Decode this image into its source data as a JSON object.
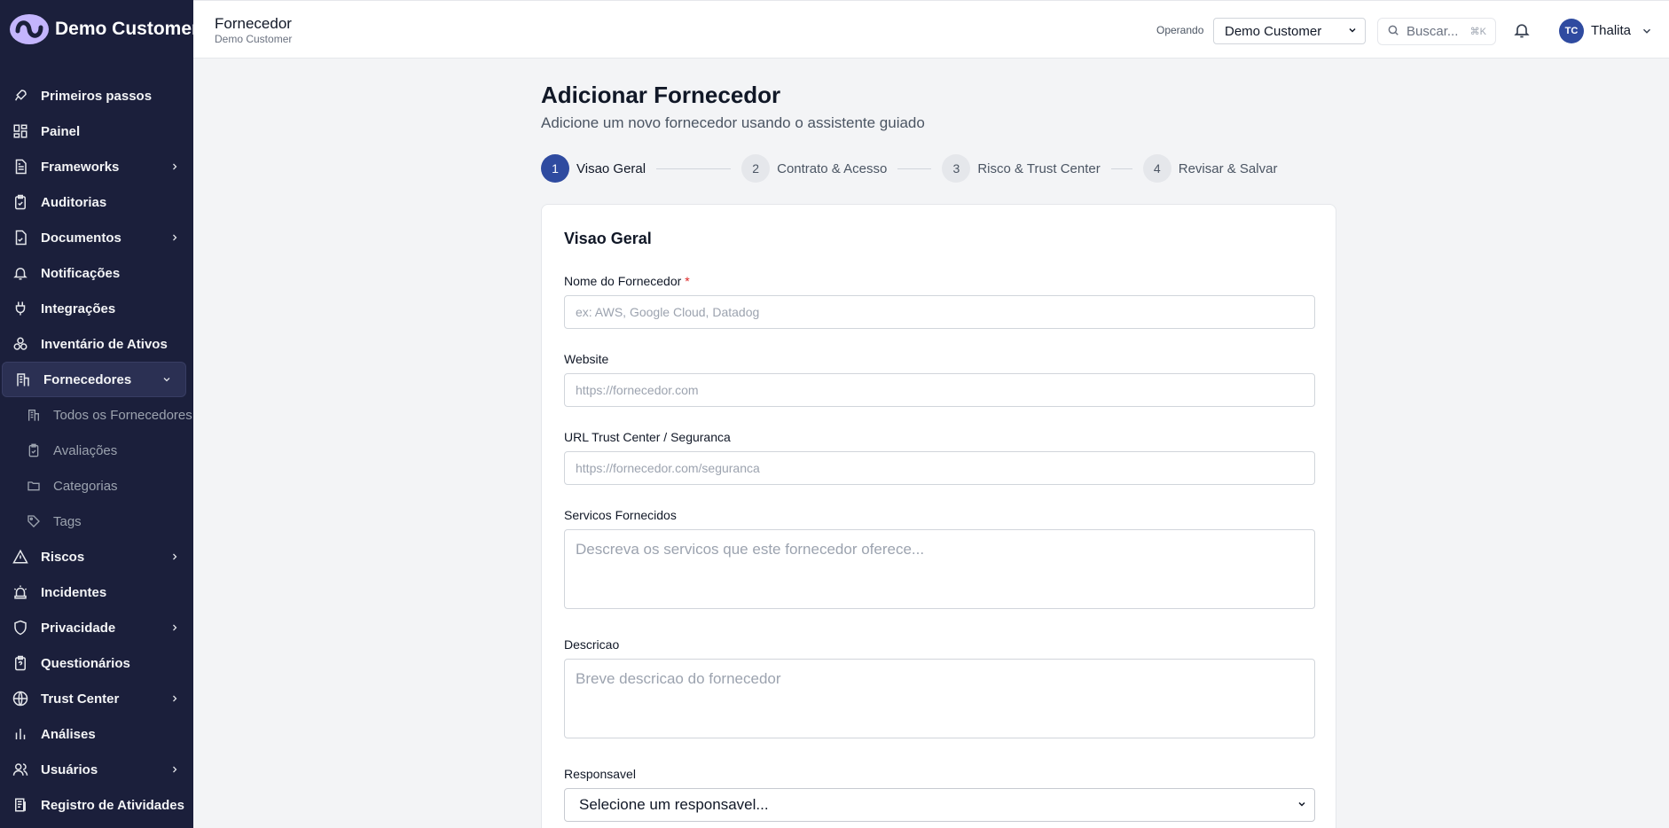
{
  "brand": {
    "name": "Demo Customer"
  },
  "sidebar": {
    "items": [
      {
        "label": "Primeiros passos",
        "icon": "rocket-icon"
      },
      {
        "label": "Painel",
        "icon": "dashboard-icon"
      },
      {
        "label": "Frameworks",
        "icon": "document-icon"
      },
      {
        "label": "Auditorias",
        "icon": "clipboard-check-icon"
      },
      {
        "label": "Documentos",
        "icon": "file-check-icon"
      },
      {
        "label": "Notificações",
        "icon": "bell-icon"
      },
      {
        "label": "Integrações",
        "icon": "plug-icon"
      },
      {
        "label": "Inventário de Ativos",
        "icon": "boxes-icon"
      },
      {
        "label": "Fornecedores",
        "icon": "building-icon"
      },
      {
        "label": "Riscos",
        "icon": "warning-icon"
      },
      {
        "label": "Incidentes",
        "icon": "siren-icon"
      },
      {
        "label": "Privacidade",
        "icon": "shield-icon"
      },
      {
        "label": "Questionários",
        "icon": "questionnaire-icon"
      },
      {
        "label": "Trust Center",
        "icon": "globe-icon"
      },
      {
        "label": "Análises",
        "icon": "bar-chart-icon"
      },
      {
        "label": "Usuários",
        "icon": "users-icon"
      },
      {
        "label": "Registro de Atividades",
        "icon": "activity-log-icon"
      }
    ],
    "subitems": [
      {
        "label": "Todos os Fornecedores",
        "icon": "building-icon"
      },
      {
        "label": "Avaliações",
        "icon": "assessment-icon"
      },
      {
        "label": "Categorias",
        "icon": "folder-icon"
      },
      {
        "label": "Tags",
        "icon": "tag-icon"
      }
    ]
  },
  "header": {
    "title": "Fornecedor",
    "subtitle": "Demo Customer",
    "operating_label": "Operando",
    "org_selected": "Demo Customer",
    "search_placeholder": "Buscar...",
    "search_shortcut": "⌘K",
    "user_initials": "TC",
    "user_name": "Thalita"
  },
  "main": {
    "title": "Adicionar Fornecedor",
    "subtitle": "Adicione um novo fornecedor usando o assistente guiado",
    "steps": [
      {
        "num": "1",
        "label": "Visao Geral"
      },
      {
        "num": "2",
        "label": "Contrato & Acesso"
      },
      {
        "num": "3",
        "label": "Risco & Trust Center"
      },
      {
        "num": "4",
        "label": "Revisar & Salvar"
      }
    ],
    "active_step": 1,
    "card": {
      "title": "Visao Geral",
      "fields": {
        "name_label": "Nome do Fornecedor",
        "name_required": "*",
        "name_placeholder": "ex: AWS, Google Cloud, Datadog",
        "website_label": "Website",
        "website_placeholder": "https://fornecedor.com",
        "trust_label": "URL Trust Center / Seguranca",
        "trust_placeholder": "https://fornecedor.com/seguranca",
        "services_label": "Servicos Fornecidos",
        "services_placeholder": "Descreva os servicos que este fornecedor oferece...",
        "description_label": "Descricao",
        "description_placeholder": "Breve descricao do fornecedor",
        "owner_label": "Responsavel",
        "owner_selected": "Selecione um responsavel..."
      }
    }
  },
  "colors": {
    "sidebar_bg": "#1b1f3b",
    "accent": "#2f4ba0",
    "required": "#dc2626"
  }
}
